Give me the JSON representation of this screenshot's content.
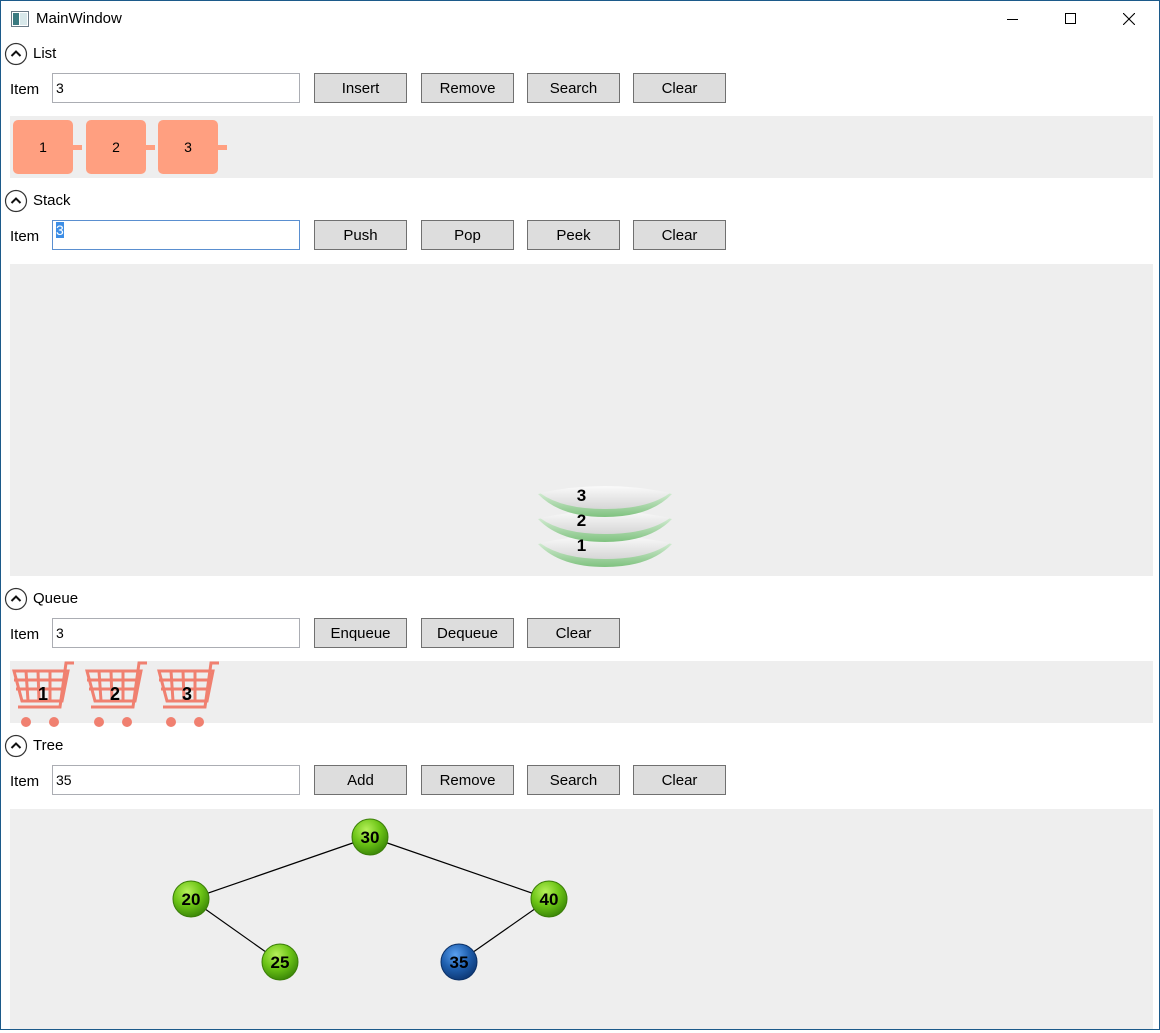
{
  "window": {
    "title": "MainWindow"
  },
  "list": {
    "header": "List",
    "item_label": "Item",
    "item_value": "3",
    "buttons": [
      "Insert",
      "Remove",
      "Search",
      "Clear"
    ],
    "nodes": [
      "1",
      "2",
      "3"
    ]
  },
  "stack": {
    "header": "Stack",
    "item_label": "Item",
    "item_value": "3",
    "buttons": [
      "Push",
      "Pop",
      "Peek",
      "Clear"
    ],
    "plates": [
      "3",
      "2",
      "1"
    ]
  },
  "queue": {
    "header": "Queue",
    "item_label": "Item",
    "item_value": "3",
    "buttons": [
      "Enqueue",
      "Dequeue",
      "Clear"
    ],
    "carts": [
      "1",
      "2",
      "3"
    ]
  },
  "tree": {
    "header": "Tree",
    "item_label": "Item",
    "item_value": "35",
    "buttons": [
      "Add",
      "Remove",
      "Search",
      "Clear"
    ],
    "nodes": [
      {
        "value": "30",
        "highlighted": false
      },
      {
        "value": "20",
        "highlighted": false
      },
      {
        "value": "40",
        "highlighted": false
      },
      {
        "value": "25",
        "highlighted": false
      },
      {
        "value": "35",
        "highlighted": true
      }
    ],
    "edges": [
      [
        "30",
        "20"
      ],
      [
        "30",
        "40"
      ],
      [
        "20",
        "25"
      ],
      [
        "40",
        "35"
      ]
    ]
  },
  "colors": {
    "list_node": "#ff9f80",
    "panel_bg": "#eeeeee",
    "tree_node_green": "#6cc416",
    "tree_node_highlight": "#1f5fae",
    "cart": "#f08070",
    "plate_rim": "#8fcf8f"
  },
  "icons": {
    "app": "window-app-icon",
    "minimize": "minimize-icon",
    "maximize": "maximize-icon",
    "close": "close-icon",
    "expander": "chevron-up-circle-icon",
    "cart": "shopping-cart-icon",
    "plate": "plate-icon"
  }
}
